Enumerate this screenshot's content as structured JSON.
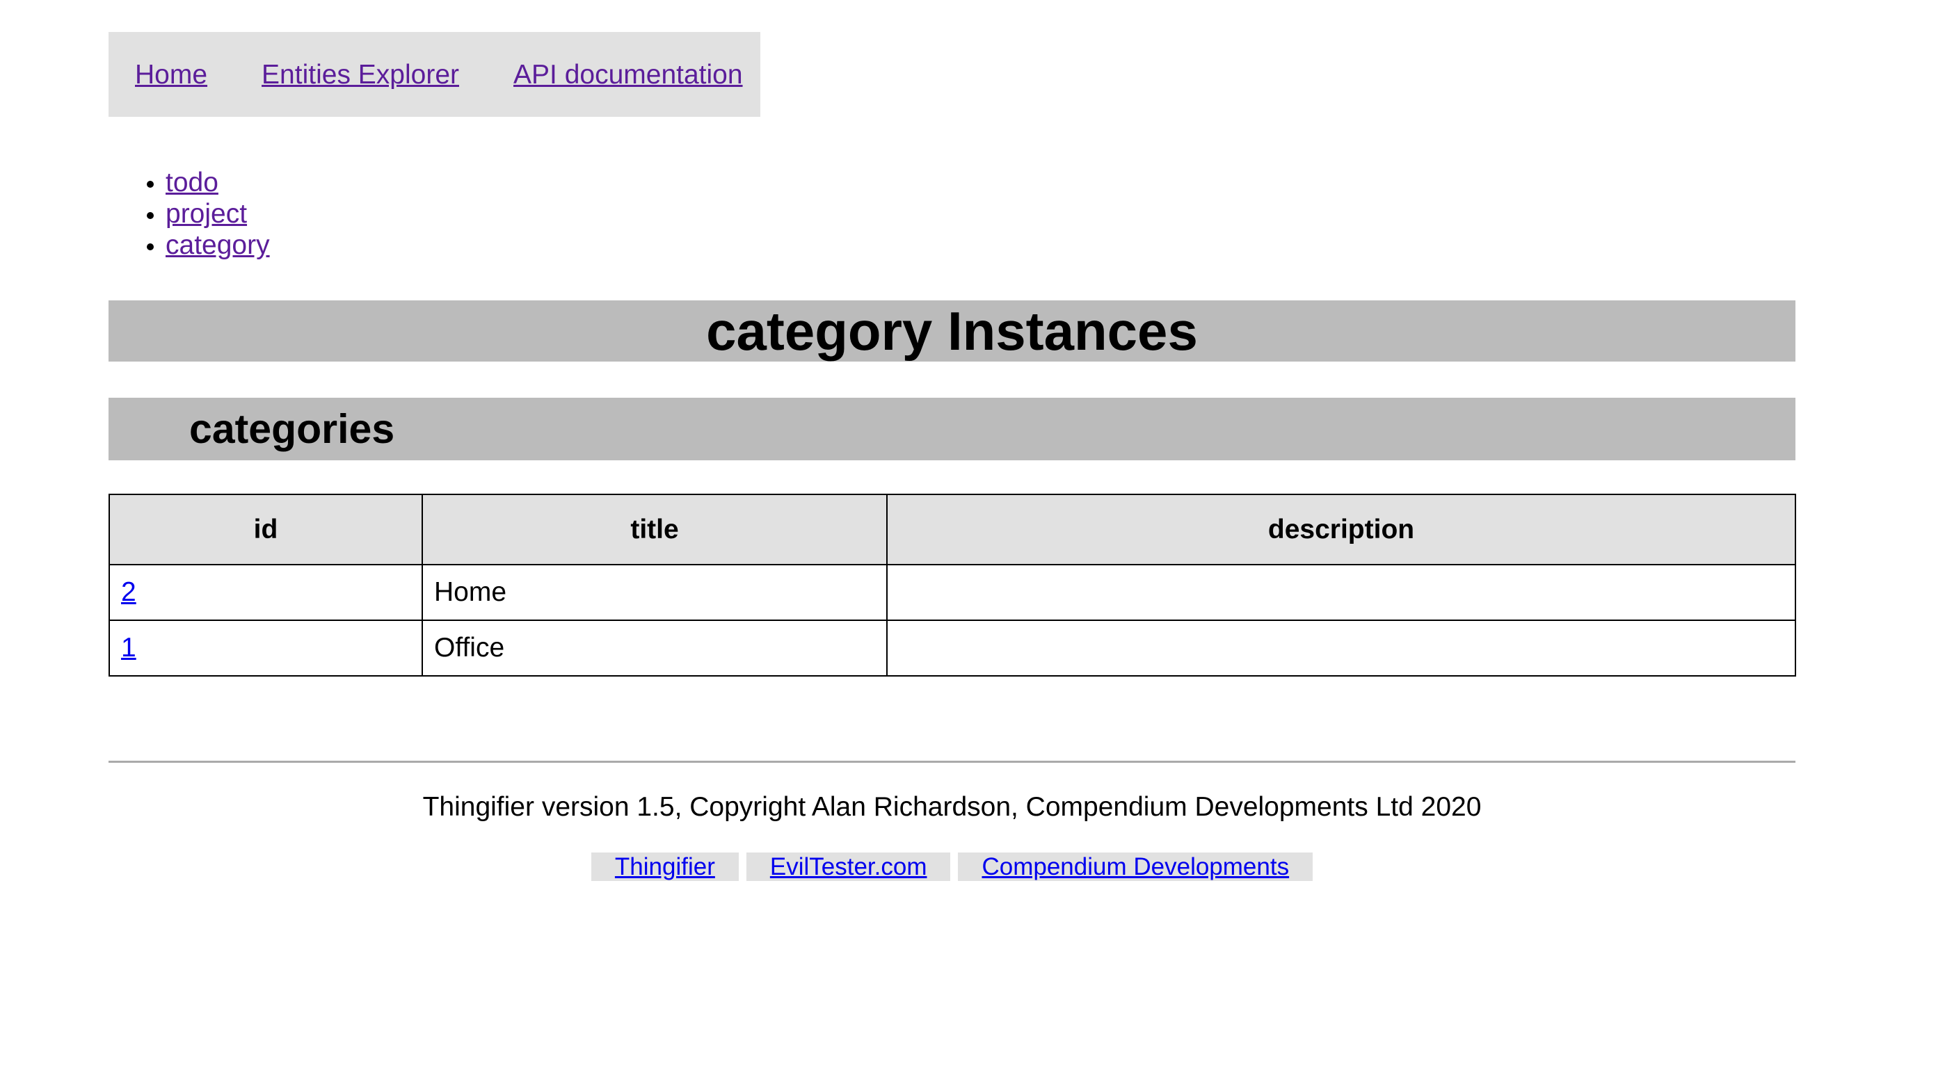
{
  "nav": {
    "home": "Home",
    "entities_explorer": "Entities Explorer",
    "api_documentation": "API documentation"
  },
  "entities": [
    "todo",
    "project",
    "category"
  ],
  "page_title": "category Instances",
  "section_title": "categories",
  "table": {
    "headers": [
      "id",
      "title",
      "description"
    ],
    "rows": [
      {
        "id": "2",
        "title": "Home",
        "description": ""
      },
      {
        "id": "1",
        "title": "Office",
        "description": ""
      }
    ]
  },
  "footer": {
    "copyright": "Thingifier version 1.5, Copyright Alan Richardson, Compendium Developments Ltd 2020",
    "links": [
      "Thingifier",
      "EvilTester.com",
      "Compendium Developments"
    ]
  },
  "colors": {
    "nav_bg": "#e1e1e1",
    "heading_bg": "#bbbbbb",
    "visited_link": "#5b1d9a",
    "link": "#0000ee"
  }
}
